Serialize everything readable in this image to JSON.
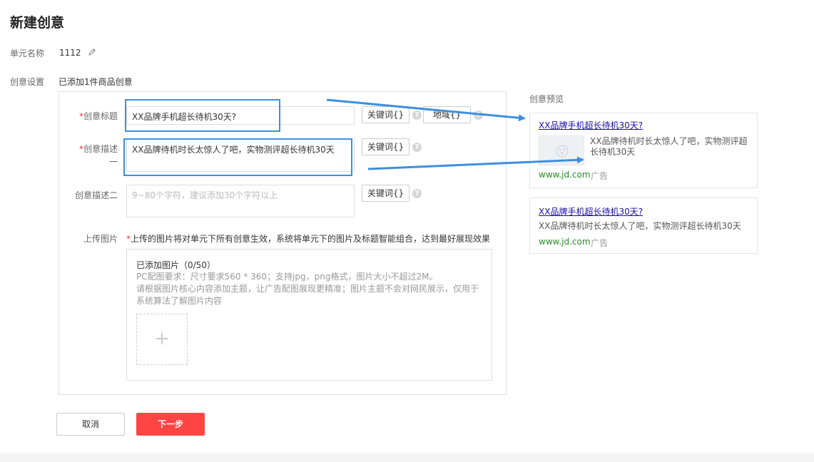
{
  "page": {
    "title": "新建创意"
  },
  "unit": {
    "label": "单元名称",
    "value": "1112",
    "edit_icon": "pencil-icon"
  },
  "creative": {
    "label": "创意设置",
    "summary": "已添加1件商品创意"
  },
  "form": {
    "required_mark": "*",
    "title_label": "创意标题",
    "title_value": "XX品牌手机超长待机30天?",
    "desc1_label_line1": "创意描述",
    "desc1_label_line2": "一",
    "desc1_value": "XX品牌待机时长太惊人了吧，实物测评超长待机30天",
    "desc2_label": "创意描述二",
    "desc2_placeholder": "9~80个字符，建议添加30个字符以上",
    "keyword_btn": "关键词{}",
    "region_btn": "地域{}",
    "help_icon": "?",
    "upload_label": "上传图片",
    "upload_notice": "上传的图片将对单元下所有创意生效，系统将单元下的图片及标题智能组合，达到最好展现效果",
    "upload_count": "已添加图片（0/50）",
    "upload_req": "PC配图要求：尺寸要求560 * 360；支持jpg，png格式，图片大小不超过2M。",
    "upload_tip_line1": "请根据图片核心内容添加主题，让广告配图展现更精准；图片主题不会对网民展示，仅用于",
    "upload_tip_line2": "系统算法了解图片内容",
    "add_icon": "+"
  },
  "preview": {
    "label": "创意预览",
    "card1": {
      "title": "XX品牌手机超长待机30天?",
      "desc_line1": "XX品牌待机时长太惊人了吧，实物测评超",
      "desc_line2": "长待机30天",
      "url": "www.jd.com",
      "ad": "广告"
    },
    "card2": {
      "title": "XX品牌手机超长待机30天?",
      "desc": "XX品牌待机时长太惊人了吧，实物测评超长待机30天",
      "url": "www.jd.com",
      "ad": "广告"
    }
  },
  "actions": {
    "cancel": "取消",
    "next": "下一步"
  },
  "colors": {
    "accent": "#ff4444",
    "highlight": "#3d8fde",
    "link": "#1a0dab",
    "url": "#2b8a2b"
  }
}
